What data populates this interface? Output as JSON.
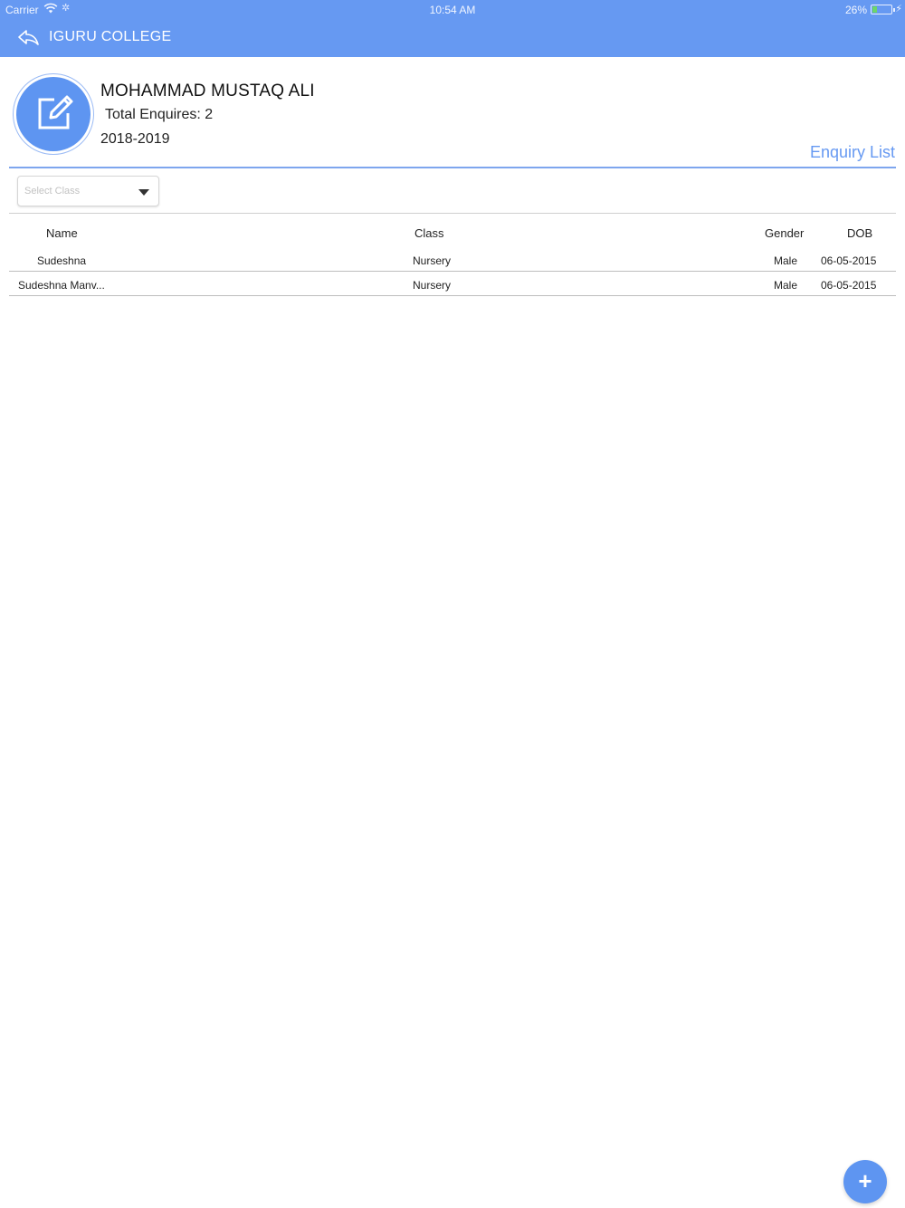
{
  "status_bar": {
    "carrier": "Carrier",
    "time": "10:54 AM",
    "battery_percent": "26%",
    "battery_level": 0.26
  },
  "header": {
    "title": "IGURU COLLEGE",
    "back_icon": "back-arrow-icon",
    "color": "#6699f2"
  },
  "profile": {
    "name": "MOHAMMAD MUSTAQ ALI",
    "total_enquiries": "Total Enquires: 2",
    "academic_year": "2018-2019",
    "avatar_icon": "edit-icon"
  },
  "section_title": "Enquiry List",
  "filter": {
    "placeholder": "Select Class"
  },
  "table": {
    "columns": {
      "name": "Name",
      "class": "Class",
      "gender": "Gender",
      "dob": "DOB"
    },
    "rows": [
      {
        "name": "Sudeshna",
        "class": "Nursery",
        "gender": "Male",
        "dob": "06-05-2015"
      },
      {
        "name": "Sudeshna Manv...",
        "class": "Nursery",
        "gender": "Male",
        "dob": "06-05-2015"
      }
    ]
  },
  "fab": {
    "label": "+",
    "icon": "plus-icon"
  },
  "colors": {
    "accent": "#6699f2",
    "avatar": "#5e95f1",
    "battery_fill": "#6dd66a"
  }
}
